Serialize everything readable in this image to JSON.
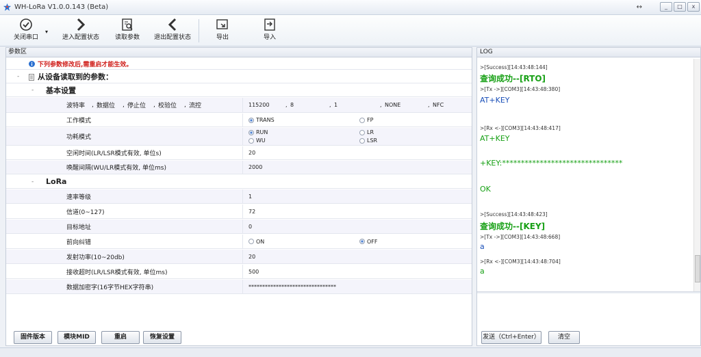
{
  "window": {
    "title": "WH-LoRa V1.0.0.143 (Beta)"
  },
  "toolbar": {
    "close_port": "关闭串口",
    "enter_config": "进入配置状态",
    "read_params": "读取参数",
    "exit_config": "退出配置状态",
    "export": "导出",
    "import": "导入"
  },
  "params": {
    "panel_title": "参数区",
    "warning": "下列参数修改后,需重启才能生效。",
    "device_params_title": "从设备读取到的参数：",
    "basic_section": "基本设置",
    "serial_labels": [
      "波特率",
      "数据位",
      "停止位",
      "校验位",
      "流控"
    ],
    "serial_values": [
      "115200",
      "8",
      "1",
      "NONE",
      "NFC"
    ],
    "work_mode_label": "工作模式",
    "work_mode_options": [
      "TRANS",
      "FP"
    ],
    "power_mode_label": "功耗模式",
    "power_mode_options": [
      "RUN",
      "WU",
      "LR",
      "LSR"
    ],
    "idle_time_label": "空闲时间(LR/LSR模式有效, 单位s)",
    "idle_time_value": "20",
    "wake_interval_label": "唤醒间隔(WU/LR模式有效, 单位ms)",
    "wake_interval_value": "2000",
    "lora_section": "LoRa",
    "rate_label": "速率等级",
    "rate_value": "1",
    "channel_label": "信道(0~127)",
    "channel_value": "72",
    "target_label": "目标地址",
    "target_value": "0",
    "fec_label": "前向纠错",
    "fec_options": [
      "ON",
      "OFF"
    ],
    "power_label": "发射功率(10~20db)",
    "power_value": "20",
    "timeout_label": "接收超时(LR/LSR模式有效, 单位ms)",
    "timeout_value": "500",
    "key_label": "数据加密字(16字节HEX字符串)",
    "key_value": "********************************"
  },
  "buttons": {
    "firmware": "固件版本",
    "module_mid": "模块MID",
    "restart": "重启",
    "restore": "恢复设置"
  },
  "log": {
    "title": "LOG",
    "lines": [
      ">[Success][14:43:48:144]",
      "查询成功--[RTO]",
      ">[Tx ->][COM3][14:43:48:380]",
      "AT+KEY",
      ">[Rx <-][COM3][14:43:48:417]",
      "AT+KEY",
      "+KEY:********************************",
      "OK",
      ">[Success][14:43:48:423]",
      "查询成功--[KEY]",
      ">[Tx ->][COM3][14:43:48:668]",
      "a",
      ">[Rx <-][COM3][14:43:48:704]",
      "a"
    ],
    "send_label": "发送（Ctrl+Enter）",
    "clear_label": "清空"
  }
}
